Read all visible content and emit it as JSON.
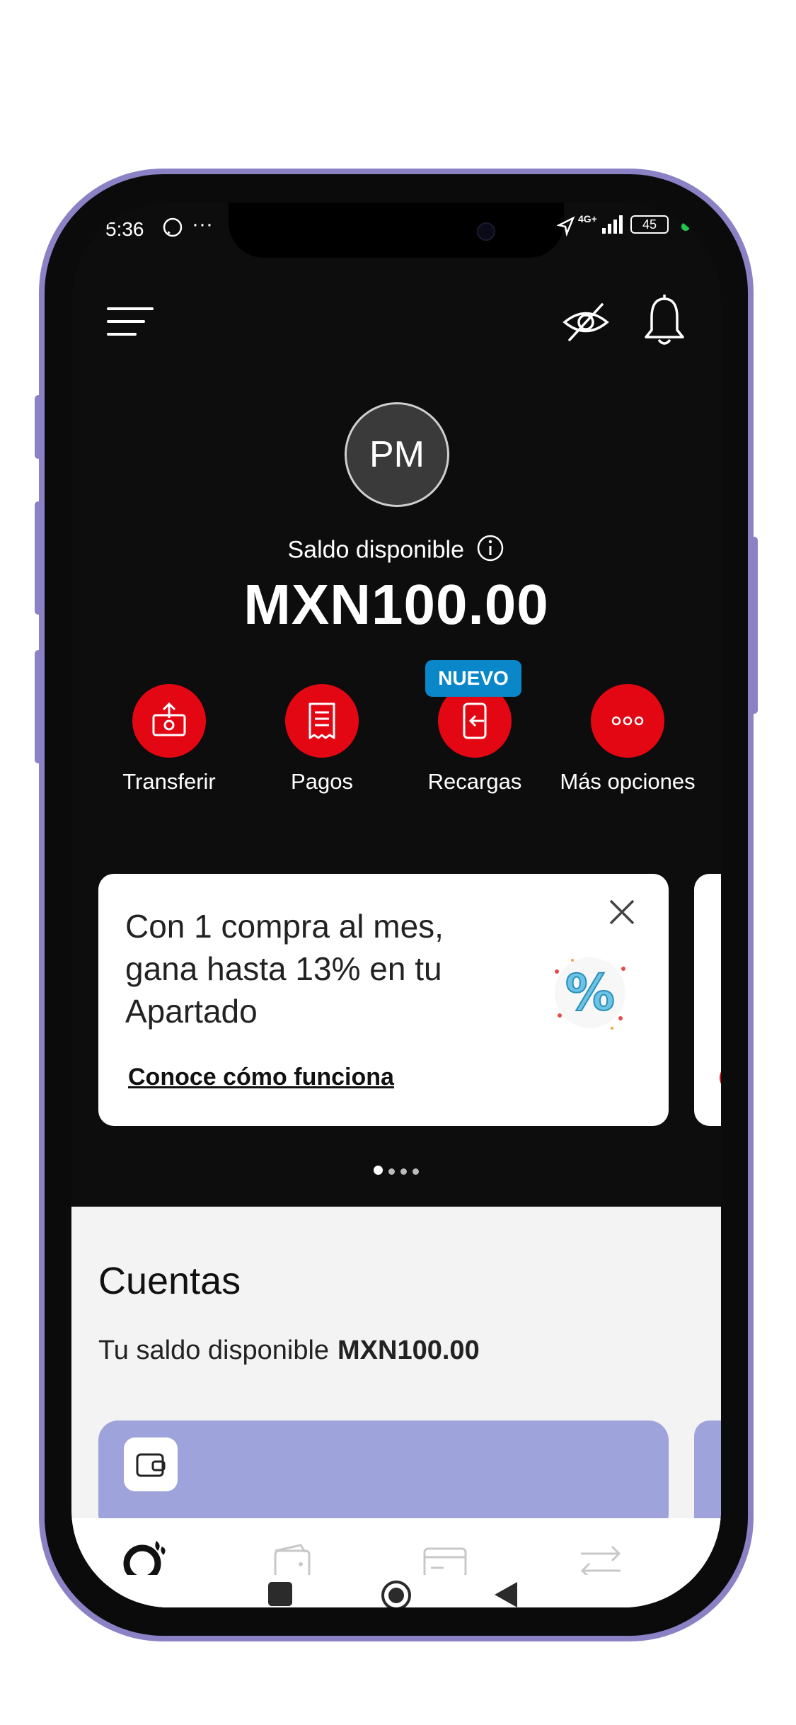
{
  "status_bar": {
    "time": "5:36",
    "notification_icons": "whatsapp-icon, more-dots",
    "network": "4G+",
    "battery": "45"
  },
  "header": {
    "menu_icon": "hamburger-menu-icon",
    "hide_balance_icon": "eye-off-icon",
    "notifications_icon": "bell-icon"
  },
  "profile": {
    "initials": "PM"
  },
  "balance": {
    "label": "Saldo disponible",
    "amount": "MXN100.00"
  },
  "actions": [
    {
      "label": "Transferir",
      "icon": "transfer-icon"
    },
    {
      "label": "Pagos",
      "icon": "receipt-icon"
    },
    {
      "label": "Recargas",
      "icon": "phone-recharge-icon",
      "badge": "NUEVO"
    },
    {
      "label": "Más opciones",
      "icon": "more-options-icon"
    }
  ],
  "promo": {
    "text": "Con 1 compra al mes, gana hasta 13% en tu Apartado",
    "link": "Conoce cómo funciona",
    "image_icon": "percent-badge-icon"
  },
  "carousel": {
    "pages": 4,
    "active": 1
  },
  "cuentas": {
    "title": "Cuentas",
    "subtitle": "Tu saldo disponible",
    "amount": "MXN100.00"
  },
  "bottom_nav": [
    {
      "icon": "home-logo-icon",
      "active": true
    },
    {
      "icon": "wallet-icon",
      "active": false
    },
    {
      "icon": "card-icon",
      "active": false
    },
    {
      "icon": "transfer-arrows-icon",
      "active": false
    }
  ],
  "colors": {
    "accent_red": "#e30613",
    "badge_blue": "#0a87c9",
    "card_lavender": "#9ea4db",
    "frame_purple": "#8b82c6"
  }
}
